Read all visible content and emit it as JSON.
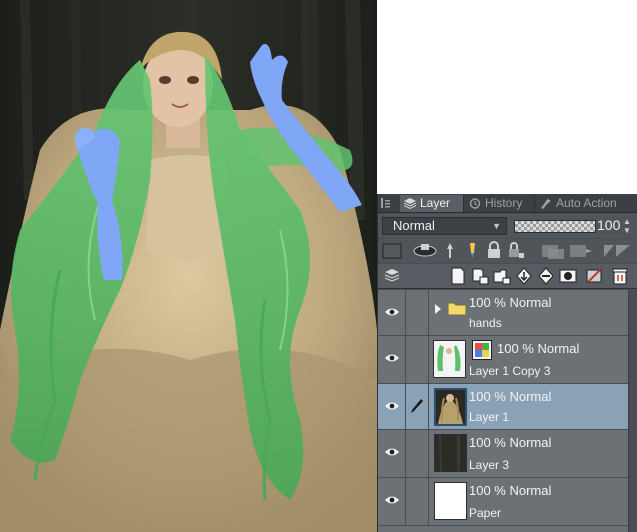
{
  "canvas": {
    "description_icon": "artwork-canvas"
  },
  "panel": {
    "tabs": [
      {
        "label": "Layer",
        "icon": "layer-stack-icon"
      },
      {
        "label": "History",
        "icon": "history-icon"
      },
      {
        "label": "Auto Action",
        "icon": "auto-action-icon"
      }
    ],
    "blend_mode": "Normal",
    "opacity_value": "100",
    "layers": [
      {
        "line1": "100 % Normal",
        "line2": "hands",
        "type": "folder",
        "visible": true,
        "selected": false
      },
      {
        "line1": "100 % Normal",
        "line2": "Layer 1 Copy 3",
        "type": "raster-with-mask",
        "visible": true,
        "selected": false
      },
      {
        "line1": "100 % Normal",
        "line2": "Layer 1",
        "type": "raster",
        "visible": true,
        "selected": true
      },
      {
        "line1": "100 % Normal",
        "line2": "Layer 3",
        "type": "raster",
        "visible": true,
        "selected": false
      },
      {
        "line1": "100 % Normal",
        "line2": "Paper",
        "type": "paper",
        "visible": true,
        "selected": false
      }
    ]
  },
  "colors": {
    "panel_bg": "#4a4e53",
    "layer_row": "#6c7176",
    "selected_row": "#8aa2b6",
    "hair_green": "#5fbf6a",
    "arm_blue": "#7fa7f5",
    "dress": "#c2ad85",
    "background_dark": "#23251f"
  }
}
